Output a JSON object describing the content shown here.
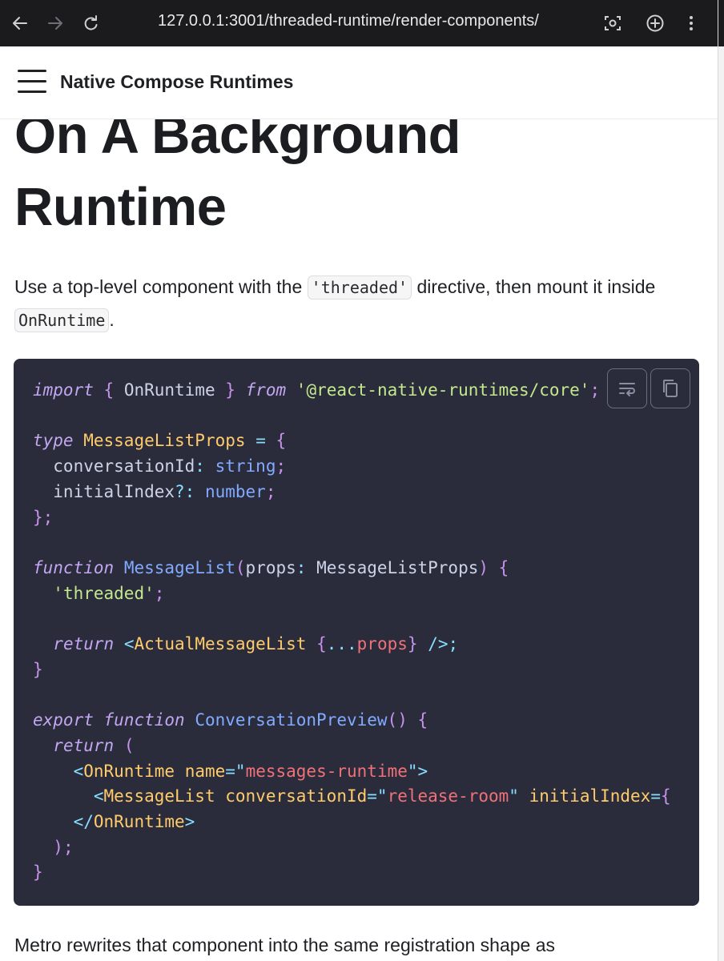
{
  "browser": {
    "url": "127.0.0.1:3001/threaded-runtime/render-components/",
    "icons": [
      "back-arrow-icon",
      "forward-arrow-icon",
      "reload-icon",
      "screenshot-icon",
      "new-tab-icon",
      "more-vertical-icon"
    ]
  },
  "header": {
    "site_title": "Native Compose Runtimes"
  },
  "heading": {
    "line1": "On A Background",
    "line2": "Runtime"
  },
  "intro": {
    "part1": "Use a top-level component with the ",
    "code1": "'threaded'",
    "part2": " directive, then mount it inside ",
    "code2": "OnRuntime",
    "part3": "."
  },
  "code_buttons": {
    "wrap": "wrap-lines-icon",
    "copy": "copy-icon"
  },
  "footer_text": "Metro rewrites that component into the same registration shape as",
  "colors": {
    "code_bg": "#2a2c3c",
    "chrome_bg": "#1b1b1d"
  }
}
